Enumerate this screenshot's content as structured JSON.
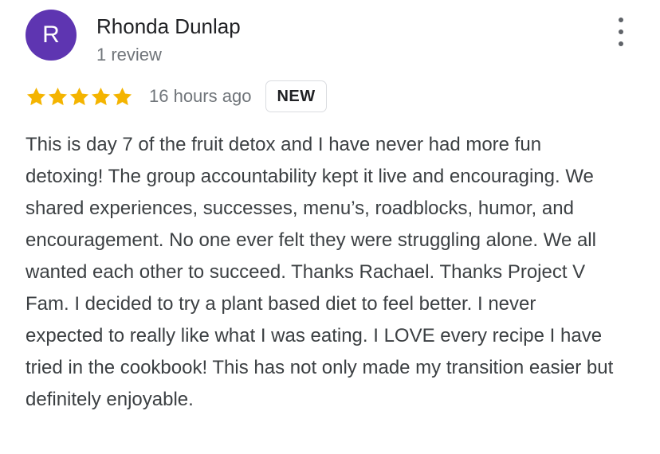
{
  "reviewer": {
    "avatar_letter": "R",
    "name": "Rhonda Dunlap",
    "review_count": "1 review"
  },
  "rating": {
    "stars": 5,
    "max_stars": 5,
    "star_color": "#f4b400"
  },
  "timestamp": "16 hours ago",
  "badge": "NEW",
  "review_text": "This is day 7 of the fruit detox and I have never had more fun detoxing!  The group accountability kept it live and encouraging. We shared experiences, successes, menu’s, roadblocks, humor, and encouragement. No one ever felt they were struggling alone. We all wanted each other to succeed. Thanks Rachael. Thanks Project V Fam. I decided to try a plant based diet to feel better. I never expected to really like what I was eating. I LOVE every recipe I have tried in the cookbook!  This has not only made my transition easier but definitely enjoyable.",
  "icons": {
    "more_options": "more-vert-icon",
    "star": "star-icon"
  },
  "colors": {
    "avatar_bg": "#5e35b1",
    "badge_border": "#dadce0",
    "secondary_text": "#70757a"
  }
}
